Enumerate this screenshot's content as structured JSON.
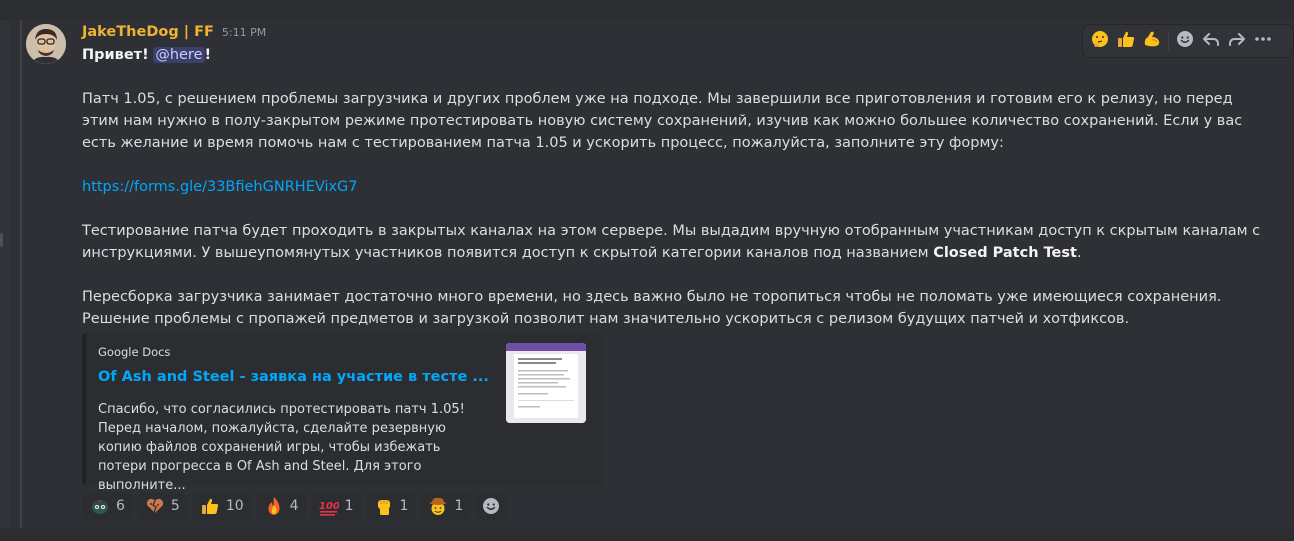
{
  "message": {
    "username": "JakeTheDog | FF",
    "timestamp": "5:11 PM",
    "greeting": "Привет!",
    "mention": "@here",
    "greeting_end": "!",
    "paragraph1": "Патч 1.05, с решением проблемы загрузчика и других проблем уже на подходе. Мы завершили все приготовления и готовим его к релизу, но перед этим нам нужно в полу-закрытом режиме протестировать новую систему сохранений, изучив как можно большее количество сохранений. Если у вас есть желание и время помочь нам с тестированием патча 1.05 и ускорить процесс, пожалуйста, заполните эту форму:",
    "link": "https://forms.gle/33BfiehGNRHEVixG7",
    "paragraph2_a": "Тестирование патча будет проходить в закрытых каналах на этом сервере. Мы выдадим вручную отобранным участникам доступ к скрытым каналам с инструкциями. У вышеупомянутых участников появится доступ к скрытой категории каналов под названием ",
    "paragraph2_bold": "Closed Patch Test",
    "paragraph2_end": ".",
    "paragraph3": "Пересборка загрузчика занимает достаточно много времени, но здесь важно было не торопиться чтобы не поломать уже имеющиеся сохранения. Решение проблемы с пропажей предметов и загрузкой позволит нам значительно ускориться с релизом будущих патчей и хотфиксов."
  },
  "embed": {
    "provider": "Google Docs",
    "title": "Of Ash and Steel - заявка на участие в тесте ...",
    "description": "Спасибо, что согласились протестировать патч 1.05! Перед началом, пожалуйста, сделайте резервную копию файлов сохранений игры, чтобы избежать потери прогресса в Of Ash and Steel. Для этого выполните..."
  },
  "reactions": [
    {
      "icon": "custom-face-emoji",
      "count": "6"
    },
    {
      "icon": "broken-heart-emoji",
      "count": "5"
    },
    {
      "icon": "thumbs-up-emoji",
      "count": "10"
    },
    {
      "icon": "fire-emoji",
      "count": "4"
    },
    {
      "icon": "hundred-points-emoji",
      "count": "1"
    },
    {
      "icon": "raised-fist-emoji",
      "count": "1"
    },
    {
      "icon": "cowboy-face-emoji",
      "count": "1"
    }
  ],
  "toolbar": {
    "quick_reactions": [
      "thinking-face-emoji",
      "thumbs-up-emoji",
      "flexed-biceps-emoji"
    ],
    "actions": [
      "add-reaction-icon",
      "reply-icon",
      "forward-icon",
      "more-icon"
    ]
  },
  "colors": {
    "background": "#313338",
    "username": "#f0b232",
    "link": "#00a8fc",
    "mention_bg": "#3c4270"
  }
}
